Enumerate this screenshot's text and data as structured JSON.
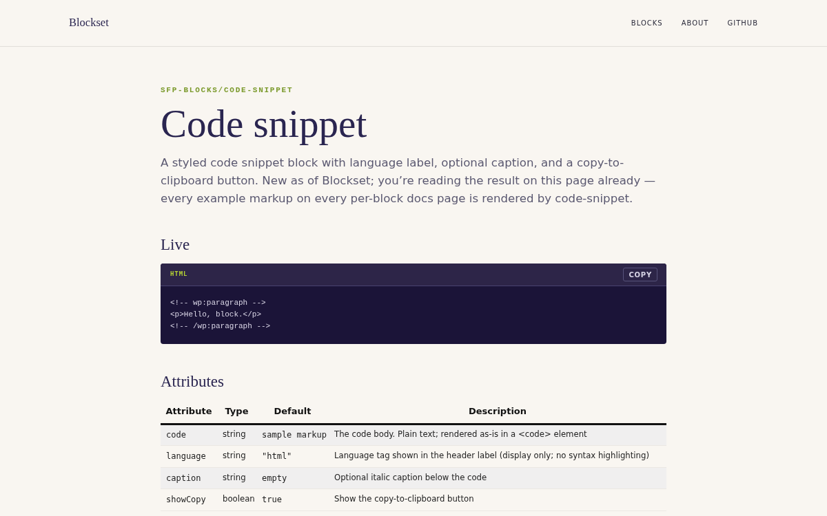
{
  "header": {
    "logo": "Blockset",
    "nav": [
      "BLOCKS",
      "ABOUT",
      "GITHUB"
    ]
  },
  "eyebrow": "SFP-BLOCKS/CODE-SNIPPET",
  "title": "Code snippet",
  "lead": "A styled code snippet block with language label, optional caption, and a copy-to-clipboard button. New as of Blockset; you’re reading the result on this page already — every example markup on every per-block docs page is rendered by code-snippet.",
  "live": {
    "heading": "Live",
    "snippet": {
      "language": "HTML",
      "copy_button": "COPY",
      "lines": [
        "<!-- wp:paragraph -->",
        "<p>Hello, block.</p>",
        "<!-- /wp:paragraph -->"
      ]
    }
  },
  "attributes": {
    "heading": "Attributes",
    "table": {
      "columns": [
        "Attribute",
        "Type",
        "Default",
        "Description"
      ],
      "rows": [
        [
          "code",
          "string",
          "sample markup",
          "The code body. Plain text; rendered as-is in a <code> element"
        ],
        [
          "language",
          "string",
          "\"html\"",
          "Language tag shown in the header label (display only; no syntax highlighting)"
        ],
        [
          "caption",
          "string",
          "empty",
          "Optional italic caption below the code"
        ],
        [
          "showCopy",
          "boolean",
          "true",
          "Show the copy-to-clipboard button"
        ]
      ]
    }
  }
}
